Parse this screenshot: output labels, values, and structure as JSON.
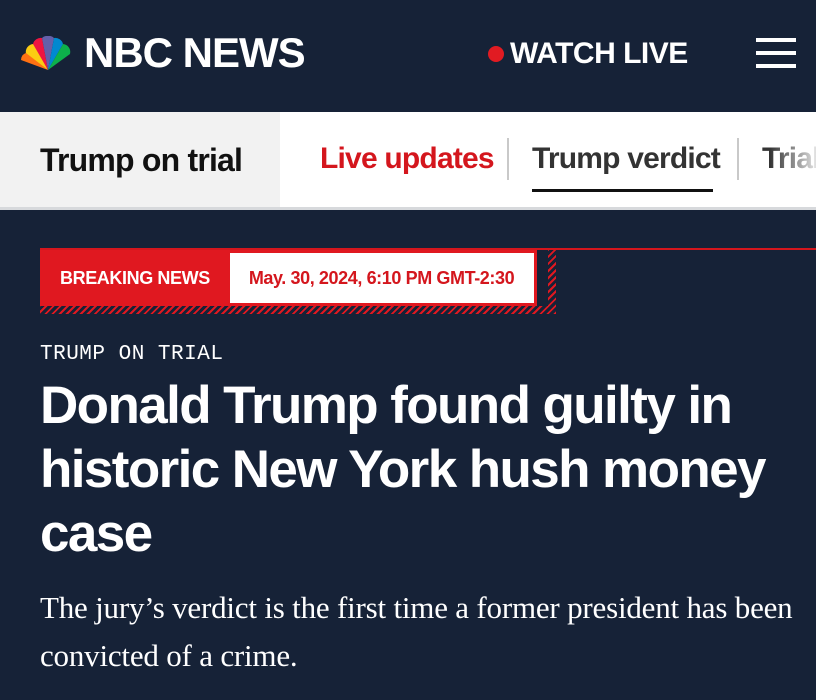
{
  "header": {
    "brand": "NBC NEWS",
    "watch_live": "WATCH LIVE",
    "colors": {
      "background": "#162237",
      "live_dot": "#e11b22"
    }
  },
  "subnav": {
    "section_title": "Trump on trial",
    "items": [
      {
        "label": "Live updates",
        "color": "#d4161d"
      },
      {
        "label": "Trump verdict",
        "active": true
      },
      {
        "label": "Trial"
      }
    ]
  },
  "breaking": {
    "label": "BREAKING NEWS",
    "timestamp": "May. 30, 2024, 6:10 PM GMT-2:30"
  },
  "article": {
    "kicker": "TRUMP ON TRIAL",
    "headline": "Donald Trump found guilty in historic New York hush money case",
    "dek": "The jury’s verdict is the first time a former president has been convicted of a crime."
  },
  "icons": [
    "nbc-peacock-logo",
    "live-dot-icon",
    "hamburger-menu-icon"
  ]
}
